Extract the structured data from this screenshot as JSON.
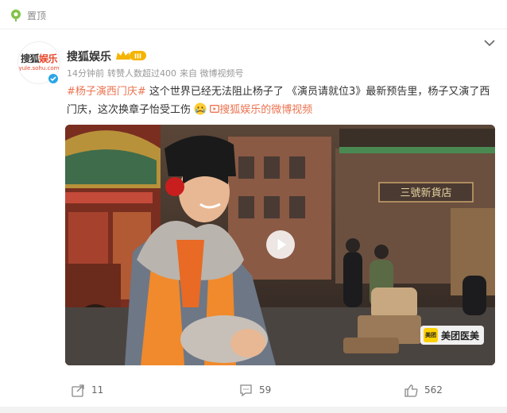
{
  "pinned": {
    "label": "置顶",
    "icon": "pin-icon"
  },
  "author": {
    "avatar_brand_part1": "搜狐",
    "avatar_brand_part2": "娱乐",
    "avatar_domain": "yule.sohu.com",
    "name": "搜狐娱乐",
    "badge": "III",
    "time": "14分钟前",
    "reposts_info": "转赞人数超过400",
    "source": "来自 微博视频号"
  },
  "post": {
    "hashtag": "#杨子演西门庆#",
    "text1": " 这个世界已经无法阻止杨子了    《演员请就位3》最新预告里，杨子又演了西门庆，这次换章子怡受工伤",
    "emoji": "crying-face-icon",
    "video_link": "搜狐娱乐的微博视频"
  },
  "video": {
    "sign_text": "三號新貨店",
    "watermark_logo": "美团",
    "watermark_text": "美团医美"
  },
  "actions": {
    "repost_count": "11",
    "comment_count": "59",
    "like_count": "562"
  },
  "colors": {
    "link": "#eb7350",
    "verify": "#2aa6e6",
    "crown": "#f5b400"
  }
}
